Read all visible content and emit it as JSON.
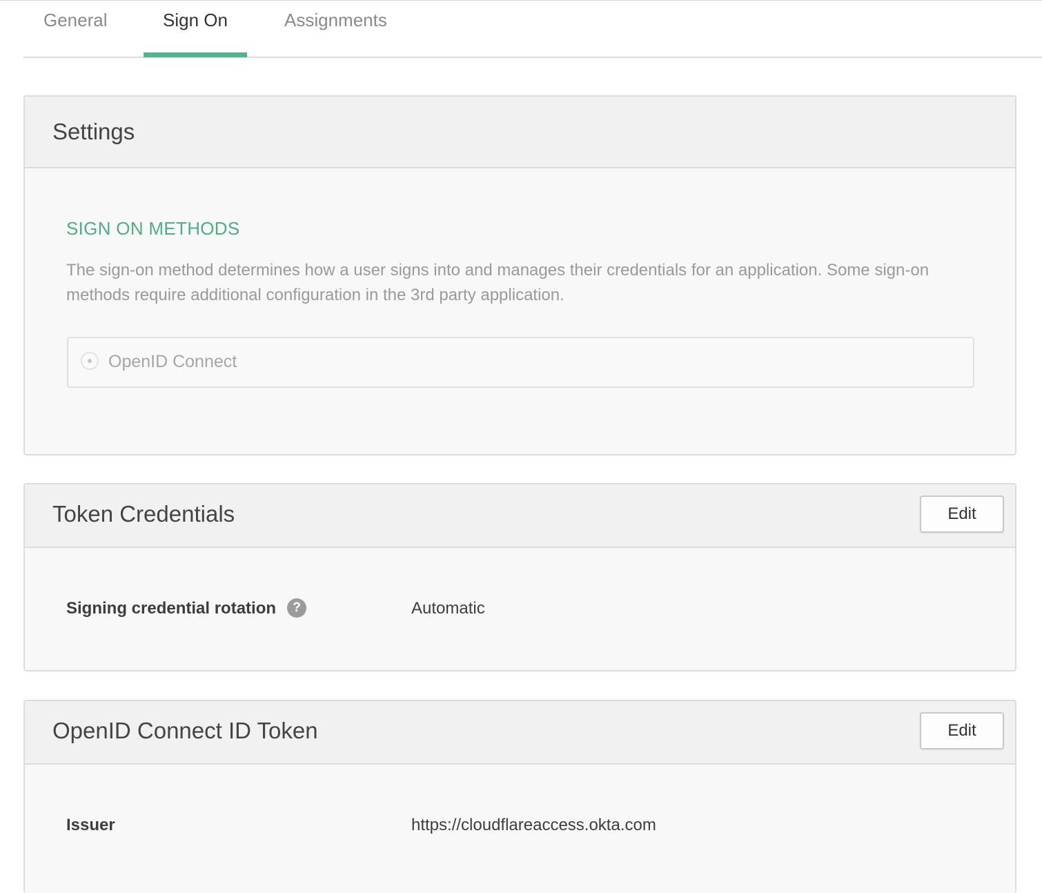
{
  "tabs": [
    {
      "label": "General",
      "active": false
    },
    {
      "label": "Sign On",
      "active": true
    },
    {
      "label": "Assignments",
      "active": false
    }
  ],
  "accent_color": "#4fb58a",
  "settings": {
    "title": "Settings",
    "section_heading": "SIGN ON METHODS",
    "description": "The sign-on method determines how a user signs into and manages their credentials for an application. Some sign-on methods require additional configuration in the 3rd party application.",
    "method": {
      "label": "OpenID Connect",
      "selected": true
    }
  },
  "token_credentials": {
    "title": "Token Credentials",
    "edit_label": "Edit",
    "fields": [
      {
        "label": "Signing credential rotation",
        "help_icon": "?",
        "value": "Automatic"
      }
    ]
  },
  "id_token": {
    "title": "OpenID Connect ID Token",
    "edit_label": "Edit",
    "fields": [
      {
        "label": "Issuer",
        "value": "https://cloudflareaccess.okta.com"
      }
    ]
  }
}
